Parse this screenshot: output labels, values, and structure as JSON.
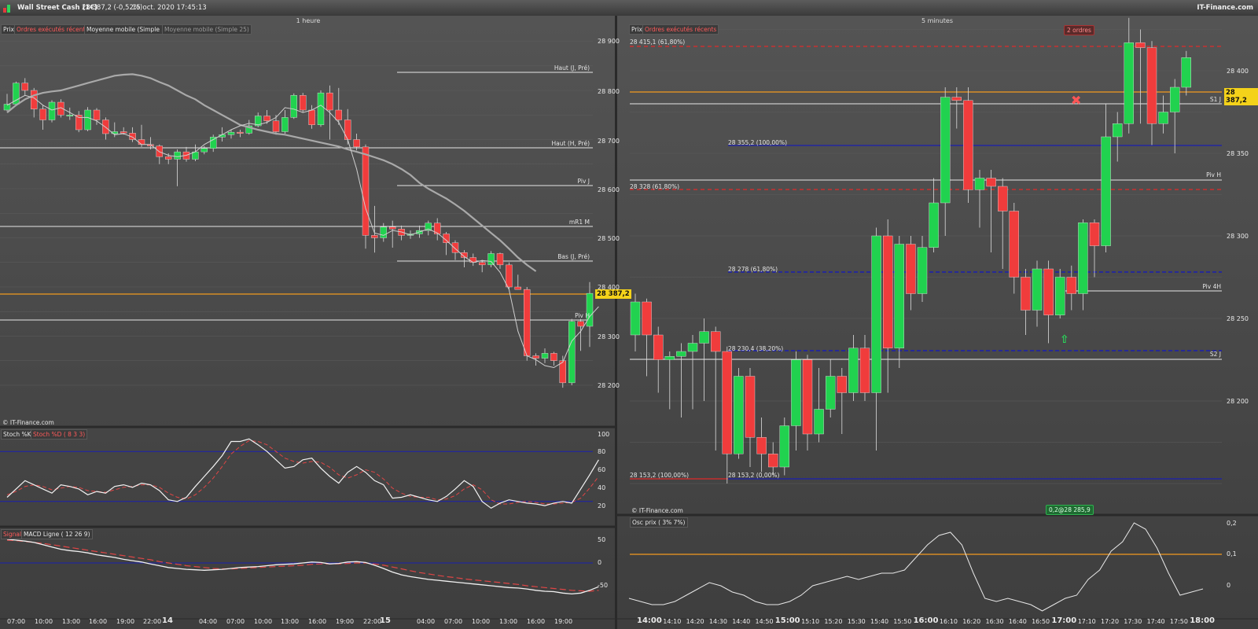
{
  "titlebar": {
    "instrument": "Wall Street Cash (1€)",
    "quote": "28 387,2 (-0,52%)",
    "datetime": "15 oct. 2020 17:45:13",
    "brand": "IT-Finance.com"
  },
  "left": {
    "timeframe": "1 heure",
    "tabs": [
      "Prix",
      "Ordres exécutés récents",
      "Moyenne mobile (Simple 3)",
      "Moyenne mobile (Simple 25)"
    ],
    "copyright": "© IT-Finance.com",
    "price_axis": [
      "28 900",
      "28 800",
      "28 700",
      "28 600",
      "28 500",
      "28 400",
      "28 300",
      "28 200"
    ],
    "current_price": "28 387,2",
    "levels": [
      "Haut (J, Pré)",
      "Haut (H, Pré)",
      "Piv J",
      "mR1 M",
      "Bas (J, Pré)",
      "Piv H"
    ],
    "stoch_tabs": [
      "Stoch %K",
      "Stoch %D ( 8 3 3)"
    ],
    "stoch_axis": [
      "100",
      "80",
      "60",
      "40",
      "20"
    ],
    "macd_tabs": [
      "Signal",
      "MACD Ligne ( 12 26 9)"
    ],
    "macd_axis": [
      "50",
      "0",
      "-50"
    ],
    "time_axis": [
      "07:00",
      "10:00",
      "13:00",
      "16:00",
      "19:00",
      "22:00",
      "14",
      "04:00",
      "07:00",
      "10:00",
      "13:00",
      "16:00",
      "19:00",
      "22:00",
      "15",
      "04:00",
      "07:00",
      "10:00",
      "13:00",
      "16:00",
      "19:00"
    ],
    "candles": [
      [
        28760,
        28772,
        28793,
        28758
      ],
      [
        28772,
        28815,
        28818,
        28768
      ],
      [
        28815,
        28800,
        28825,
        28790
      ],
      [
        28800,
        28762,
        28805,
        28745
      ],
      [
        28762,
        28740,
        28770,
        28720
      ],
      [
        28740,
        28776,
        28780,
        28735
      ],
      [
        28776,
        28750,
        28782,
        28745
      ],
      [
        28750,
        28750,
        28765,
        28740
      ],
      [
        28750,
        28720,
        28758,
        28715
      ],
      [
        28720,
        28760,
        28766,
        28717
      ],
      [
        28760,
        28740,
        28764,
        28730
      ],
      [
        28740,
        28712,
        28745,
        28700
      ],
      [
        28712,
        28716,
        28735,
        28705
      ],
      [
        28716,
        28713,
        28725,
        28710
      ],
      [
        28713,
        28700,
        28725,
        28695
      ],
      [
        28700,
        28690,
        28730,
        28685
      ],
      [
        28690,
        28687,
        28705,
        28680
      ],
      [
        28687,
        28665,
        28690,
        28650
      ],
      [
        28665,
        28660,
        28672,
        28650
      ],
      [
        28660,
        28675,
        28680,
        28605
      ],
      [
        28675,
        28660,
        28685,
        28655
      ],
      [
        28660,
        28675,
        28690,
        28656
      ],
      [
        28675,
        28682,
        28687,
        28670
      ],
      [
        28682,
        28705,
        28710,
        28675
      ],
      [
        28705,
        28710,
        28725,
        28696
      ],
      [
        28710,
        28715,
        28720,
        28702
      ],
      [
        28715,
        28713,
        28720,
        28705
      ],
      [
        28713,
        28728,
        28740,
        28710
      ],
      [
        28728,
        28748,
        28755,
        28725
      ],
      [
        28748,
        28738,
        28760,
        28732
      ],
      [
        28738,
        28716,
        28750,
        28710
      ],
      [
        28716,
        28745,
        28760,
        28712
      ],
      [
        28745,
        28790,
        28794,
        28742
      ],
      [
        28790,
        28760,
        28795,
        28755
      ],
      [
        28760,
        28730,
        28770,
        28722
      ],
      [
        28730,
        28795,
        28800,
        28726
      ],
      [
        28795,
        28760,
        28810,
        28700
      ],
      [
        28760,
        28740,
        28805,
        28730
      ],
      [
        28740,
        28700,
        28762,
        28690
      ],
      [
        28700,
        28685,
        28712,
        28678
      ],
      [
        28685,
        28505,
        28690,
        28478
      ],
      [
        28505,
        28500,
        28565,
        28470
      ],
      [
        28500,
        28522,
        28530,
        28492
      ],
      [
        28522,
        28518,
        28535,
        28480
      ],
      [
        28518,
        28505,
        28525,
        28495
      ],
      [
        28505,
        28508,
        28515,
        28498
      ],
      [
        28508,
        28515,
        28525,
        28500
      ],
      [
        28515,
        28530,
        28535,
        28505
      ],
      [
        28530,
        28508,
        28540,
        28495
      ],
      [
        28508,
        28490,
        28512,
        28465
      ],
      [
        28490,
        28470,
        28495,
        28455
      ],
      [
        28470,
        28460,
        28475,
        28440
      ],
      [
        28460,
        28450,
        28468,
        28443
      ],
      [
        28450,
        28445,
        28455,
        28430
      ],
      [
        28445,
        28468,
        28473,
        28440
      ],
      [
        28468,
        28445,
        28470,
        28437
      ],
      [
        28445,
        28400,
        28450,
        28395
      ],
      [
        28400,
        28395,
        28425,
        28395
      ],
      [
        28395,
        28260,
        28400,
        28250
      ],
      [
        28260,
        28255,
        28265,
        28240
      ],
      [
        28255,
        28265,
        28275,
        28245
      ],
      [
        28265,
        28250,
        28268,
        28240
      ],
      [
        28250,
        28205,
        28260,
        28195
      ],
      [
        28205,
        28330,
        28335,
        28200
      ],
      [
        28330,
        28320,
        28335,
        28270
      ],
      [
        28320,
        28387,
        28410,
        28278
      ]
    ],
    "sma25": [
      28755,
      28770,
      28782,
      28790,
      28795,
      28798,
      28800,
      28805,
      28810,
      28815,
      28820,
      28825,
      28830,
      28832,
      28833,
      28830,
      28825,
      28817,
      28810,
      28800,
      28790,
      28782,
      28770,
      28760,
      28750,
      28740,
      28730,
      28725,
      28720,
      28716,
      28712,
      28710,
      28706,
      28702,
      28698,
      28694,
      28690,
      28686,
      28680,
      28675,
      28670,
      28664,
      28658,
      28650,
      28640,
      28628,
      28612,
      28600,
      28590,
      28580,
      28568,
      28555,
      28540,
      28525,
      28510,
      28495,
      28478,
      28460,
      28445,
      28432
    ],
    "sma3": [
      28770,
      28780,
      28790,
      28785,
      28770,
      28760,
      28765,
      28755,
      28745,
      28745,
      28738,
      28725,
      28710,
      28712,
      28705,
      28690,
      28690,
      28675,
      28668,
      28665,
      28668,
      28675,
      28690,
      28700,
      28710,
      28720,
      28728,
      28733,
      28730,
      28735,
      28745,
      28765,
      28762,
      28755,
      28760,
      28770,
      28755,
      28735,
      28700,
      28640,
      28560,
      28510,
      28505,
      28515,
      28512,
      28506,
      28512,
      28518,
      28510,
      28495,
      28478,
      28462,
      28450,
      28454,
      28452,
      28430,
      28395,
      28310,
      28260,
      28252,
      28240,
      28236,
      28247,
      28290,
      28310,
      28340,
      28360
    ],
    "stoch_k": [
      25,
      35,
      45,
      40,
      35,
      30,
      40,
      38,
      35,
      28,
      32,
      30,
      38,
      40,
      37,
      42,
      40,
      33,
      22,
      20,
      25,
      38,
      50,
      62,
      75,
      92,
      92,
      95,
      88,
      80,
      70,
      60,
      62,
      70,
      72,
      60,
      50,
      42,
      55,
      62,
      55,
      45,
      40,
      24,
      25,
      28,
      25,
      22,
      20,
      26,
      35,
      45,
      38,
      20,
      12,
      18,
      22,
      20,
      18,
      17,
      15,
      18,
      20,
      18,
      35,
      52,
      70
    ],
    "stoch_d": [
      28,
      32,
      38,
      40,
      38,
      34,
      36,
      38,
      37,
      33,
      32,
      31,
      34,
      37,
      38,
      40,
      40,
      37,
      30,
      25,
      23,
      28,
      37,
      48,
      62,
      77,
      86,
      93,
      92,
      88,
      80,
      72,
      68,
      66,
      68,
      67,
      61,
      52,
      48,
      52,
      58,
      55,
      47,
      36,
      30,
      26,
      25,
      25,
      22,
      23,
      27,
      35,
      40,
      34,
      22,
      17,
      17,
      19,
      20,
      19,
      17,
      17,
      18,
      19,
      24,
      36,
      50
    ],
    "macd": [
      52,
      50,
      48,
      45,
      40,
      35,
      30,
      27,
      25,
      22,
      18,
      15,
      12,
      8,
      5,
      2,
      -2,
      -6,
      -10,
      -12,
      -14,
      -15,
      -16,
      -15,
      -14,
      -12,
      -10,
      -9,
      -8,
      -6,
      -4,
      -3,
      -2,
      0,
      2,
      1,
      -2,
      -1,
      2,
      3,
      1,
      -5,
      -12,
      -20,
      -26,
      -30,
      -33,
      -36,
      -38,
      -40,
      -42,
      -44,
      -46,
      -48,
      -50,
      -52,
      -54,
      -55,
      -57,
      -60,
      -62,
      -63,
      -66,
      -68,
      -66,
      -60,
      -52
    ],
    "macd_signal": [
      50,
      49,
      47,
      45,
      43,
      40,
      37,
      34,
      31,
      28,
      25,
      22,
      19,
      16,
      13,
      10,
      7,
      3,
      0,
      -3,
      -6,
      -8,
      -10,
      -12,
      -13,
      -13,
      -12,
      -11,
      -10,
      -9,
      -8,
      -7,
      -6,
      -5,
      -3,
      -2,
      -2,
      -2,
      -1,
      0,
      0,
      -2,
      -5,
      -9,
      -13,
      -17,
      -21,
      -24,
      -27,
      -30,
      -32,
      -35,
      -37,
      -39,
      -41,
      -43,
      -45,
      -47,
      -50,
      -52,
      -54,
      -56,
      -58,
      -60,
      -61,
      -62,
      -60
    ]
  },
  "right": {
    "timeframe": "5 minutes",
    "tabs": [
      "Prix",
      "Ordres exécutés récents"
    ],
    "orders_badge": "2 ordres",
    "copyright": "© IT-Finance.com",
    "execution_badge": "0,2@28 285,9",
    "price_axis": [
      "28 400",
      "28 350",
      "28 300",
      "28 250",
      "28 200"
    ],
    "current_price": "28 387,2",
    "fib_labels": [
      "28 415,1 (61,80%)",
      "28 355,2 (100,00%)",
      "28 328 (61,80%)",
      "28 278 (61,80%)",
      "28 230,4 (38,20%)",
      "28 153,2 (100,00%)",
      "28 153,2 (0,00%)"
    ],
    "levels": [
      "S1 J",
      "Piv H",
      "Piv 4H",
      "S2 J"
    ],
    "osc_tab": "Osc prix ( 3% 7%)",
    "osc_axis": [
      "0,2",
      "0,1",
      "0"
    ],
    "time_axis": [
      {
        "t": "14:00",
        "bold": true
      },
      {
        "t": "14:10",
        "bold": false
      },
      {
        "t": "14:20",
        "bold": false
      },
      {
        "t": "14:30",
        "bold": false
      },
      {
        "t": "14:40",
        "bold": false
      },
      {
        "t": "14:50",
        "bold": false
      },
      {
        "t": "15:00",
        "bold": true
      },
      {
        "t": "15:10",
        "bold": false
      },
      {
        "t": "15:20",
        "bold": false
      },
      {
        "t": "15:30",
        "bold": false
      },
      {
        "t": "15:40",
        "bold": false
      },
      {
        "t": "15:50",
        "bold": false
      },
      {
        "t": "16:00",
        "bold": true
      },
      {
        "t": "16:10",
        "bold": false
      },
      {
        "t": "16:20",
        "bold": false
      },
      {
        "t": "16:30",
        "bold": false
      },
      {
        "t": "16:40",
        "bold": false
      },
      {
        "t": "16:50",
        "bold": false
      },
      {
        "t": "17:00",
        "bold": true
      },
      {
        "t": "17:10",
        "bold": false
      },
      {
        "t": "17:20",
        "bold": false
      },
      {
        "t": "17:30",
        "bold": false
      },
      {
        "t": "17:40",
        "bold": false
      },
      {
        "t": "17:50",
        "bold": false
      },
      {
        "t": "18:00",
        "bold": true
      }
    ],
    "candles": [
      [
        28240,
        28260,
        28265,
        28230
      ],
      [
        28260,
        28240,
        28262,
        28215
      ],
      [
        28240,
        28225,
        28245,
        28205
      ],
      [
        28225,
        28227,
        28230,
        28195
      ],
      [
        28227,
        28230,
        28235,
        28190
      ],
      [
        28230,
        28235,
        28240,
        28195
      ],
      [
        28235,
        28242,
        28250,
        28200
      ],
      [
        28242,
        28230,
        28245,
        28170
      ],
      [
        28230,
        28168,
        28233,
        28150
      ],
      [
        28168,
        28215,
        28220,
        28165
      ],
      [
        28215,
        28178,
        28220,
        28160
      ],
      [
        28178,
        28168,
        28190,
        28157
      ],
      [
        28168,
        28160,
        28175,
        28155
      ],
      [
        28160,
        28185,
        28190,
        28155
      ],
      [
        28185,
        28225,
        28230,
        28170
      ],
      [
        28225,
        28180,
        28228,
        28170
      ],
      [
        28180,
        28195,
        28220,
        28175
      ],
      [
        28195,
        28215,
        28225,
        28190
      ],
      [
        28215,
        28205,
        28220,
        28180
      ],
      [
        28205,
        28232,
        28240,
        28200
      ],
      [
        28232,
        28205,
        28240,
        28200
      ],
      [
        28205,
        28300,
        28305,
        28170
      ],
      [
        28300,
        28232,
        28310,
        28205
      ],
      [
        28232,
        28295,
        28300,
        28220
      ],
      [
        28295,
        28265,
        28300,
        28255
      ],
      [
        28265,
        28293,
        28300,
        28260
      ],
      [
        28293,
        28320,
        28335,
        28290
      ],
      [
        28320,
        28384,
        28390,
        28300
      ],
      [
        28384,
        28382,
        28390,
        28365
      ],
      [
        28382,
        28328,
        28390,
        28320
      ],
      [
        28328,
        28335,
        28340,
        28305
      ],
      [
        28335,
        28330,
        28340,
        28290
      ],
      [
        28330,
        28315,
        28335,
        28280
      ],
      [
        28315,
        28275,
        28320,
        28265
      ],
      [
        28275,
        28255,
        28280,
        28240
      ],
      [
        28255,
        28280,
        28285,
        28245
      ],
      [
        28280,
        28252,
        28285,
        28235
      ],
      [
        28252,
        28275,
        28280,
        28250
      ],
      [
        28275,
        28265,
        28282,
        28255
      ],
      [
        28265,
        28308,
        28310,
        28255
      ],
      [
        28308,
        28294,
        28310,
        28275
      ],
      [
        28294,
        28360,
        28380,
        28290
      ],
      [
        28360,
        28368,
        28375,
        28345
      ],
      [
        28368,
        28417,
        28432,
        28362
      ],
      [
        28417,
        28414,
        28425,
        28368
      ],
      [
        28414,
        28368,
        28418,
        28355
      ],
      [
        28368,
        28375,
        28385,
        28362
      ],
      [
        28375,
        28390,
        28395,
        28350
      ],
      [
        28390,
        28408,
        28412,
        28385
      ]
    ],
    "osc": [
      -0.04,
      -0.05,
      -0.06,
      -0.06,
      -0.05,
      -0.03,
      -0.01,
      0.01,
      0.0,
      -0.02,
      -0.03,
      -0.05,
      -0.06,
      -0.06,
      -0.05,
      -0.03,
      0.0,
      0.01,
      0.02,
      0.03,
      0.02,
      0.03,
      0.04,
      0.04,
      0.05,
      0.09,
      0.13,
      0.16,
      0.17,
      0.13,
      0.04,
      -0.04,
      -0.05,
      -0.04,
      -0.05,
      -0.06,
      -0.08,
      -0.06,
      -0.04,
      -0.03,
      0.02,
      0.05,
      0.11,
      0.14,
      0.2,
      0.18,
      0.12,
      0.04,
      -0.03,
      -0.02,
      -0.01
    ]
  },
  "colors": {
    "up": "#21d24f",
    "down": "#f03c3c",
    "orange": "#f29a1f",
    "blue": "#1a1fb0",
    "red_dash": "#e02a2a",
    "price_tag": "#f4d21a"
  }
}
